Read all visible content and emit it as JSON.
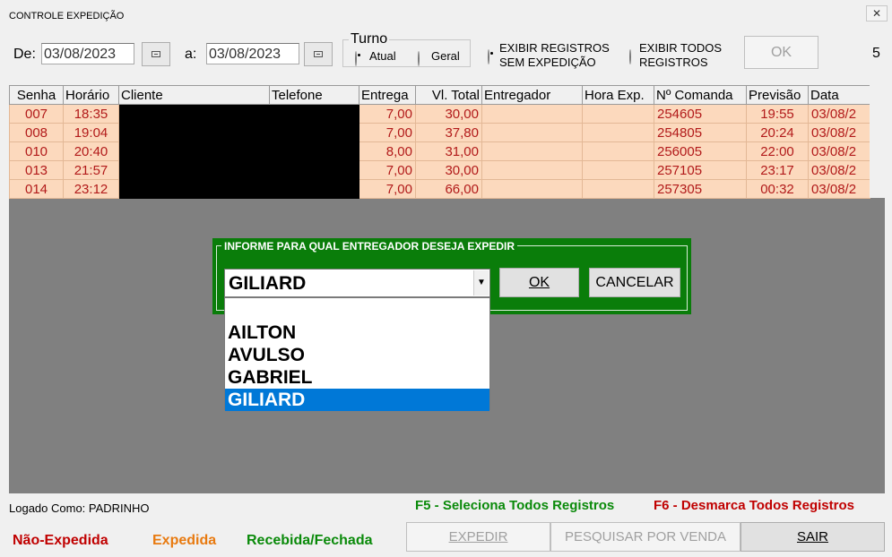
{
  "window": {
    "title": "CONTROLE EXPEDIÇÃO",
    "close_label": "✕"
  },
  "filters": {
    "from_label": "De:",
    "from_date": "03/08/2023",
    "to_label": "a:",
    "to_date": "03/08/2023",
    "turno": {
      "label": "Turno",
      "options": [
        "Atual",
        "Geral"
      ],
      "selected": "Atual"
    },
    "show_options": {
      "without_dispatch": "EXIBIR REGISTROS SEM EXPEDIÇÃO",
      "without_dispatch_line1": "EXIBIR REGISTROS",
      "without_dispatch_line2": "SEM EXPEDIÇÃO",
      "all_line1": "EXIBIR TODOS",
      "all_line2": "REGISTROS",
      "selected": "without_dispatch"
    },
    "ok_label": "OK",
    "record_count": "5"
  },
  "grid": {
    "columns": [
      "Senha",
      "Horário",
      "Cliente",
      "Telefone",
      "Entrega",
      "Vl. Total",
      "Entregador",
      "Hora Exp.",
      "Nº Comanda",
      "Previsão",
      "Data"
    ],
    "rows": [
      [
        "007",
        "18:35",
        "",
        "",
        "7,00",
        "30,00",
        "",
        "",
        "254605",
        "19:55",
        "03/08/2"
      ],
      [
        "008",
        "19:04",
        "",
        "",
        "7,00",
        "37,80",
        "",
        "",
        "254805",
        "20:24",
        "03/08/2"
      ],
      [
        "010",
        "20:40",
        "",
        "",
        "8,00",
        "31,00",
        "",
        "",
        "256005",
        "22:00",
        "03/08/2"
      ],
      [
        "013",
        "21:57",
        "",
        "",
        "7,00",
        "30,00",
        "",
        "",
        "257105",
        "23:17",
        "03/08/2"
      ],
      [
        "014",
        "23:12",
        "",
        "",
        "7,00",
        "66,00",
        "",
        "",
        "257305",
        "00:32",
        "03/08/2"
      ]
    ]
  },
  "dialog": {
    "caption": "INFORME PARA QUAL ENTREGADOR DESEJA EXPEDIR",
    "selected": "GILIARD",
    "options": [
      "",
      "AILTON",
      "AVULSO",
      "GABRIEL",
      "GILIARD"
    ],
    "ok_label": "OK",
    "cancel_label": "CANCELAR"
  },
  "footer": {
    "logged_as": "Logado Como: PADRINHO",
    "f5_hint": "F5 - Seleciona Todos Registros",
    "f6_hint": "F6 - Desmarca Todos Registros",
    "legend": {
      "not_dispatched": "Não-Expedida",
      "dispatched": "Expedida",
      "received": "Recebida/Fechada"
    },
    "buttons": {
      "dispatch": "EXPEDIR",
      "search": "PESQUISAR POR VENDA",
      "exit": "SAIR"
    }
  },
  "colors": {
    "not_dispatched": "#c00000",
    "dispatched": "#e87a10",
    "received": "#0a8a0a",
    "dialog_bg": "#0a7d0a",
    "row_bg": "#fcd9bd",
    "selection": "#0078d7"
  }
}
